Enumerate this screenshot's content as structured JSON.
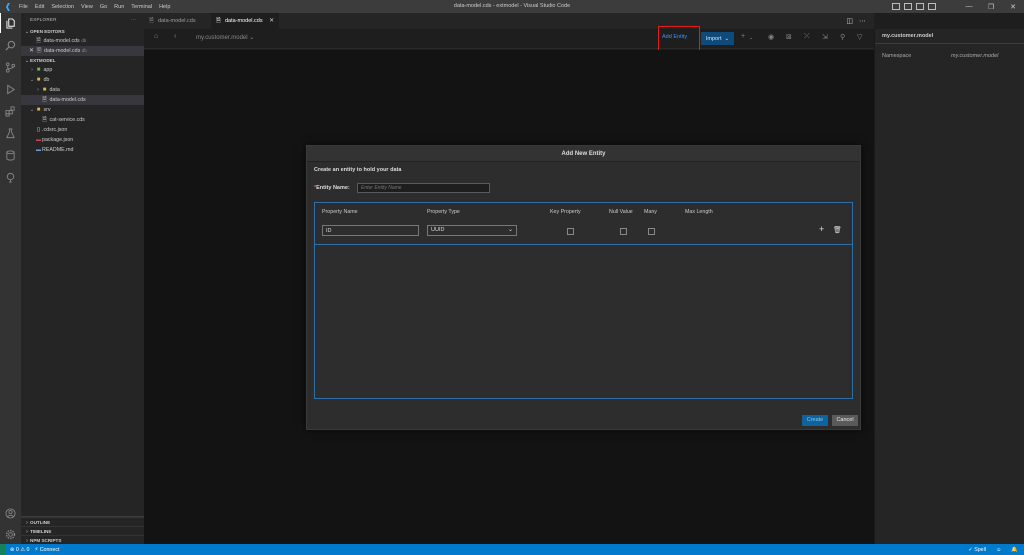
{
  "window": {
    "title": "data-model.cds - extmodel - Visual Studio Code",
    "menus": [
      "File",
      "Edit",
      "Selection",
      "View",
      "Go",
      "Run",
      "Terminal",
      "Help"
    ]
  },
  "activity_bar": {
    "icons": [
      "files-icon",
      "search-icon",
      "source-control-icon",
      "run-debug-icon",
      "extensions-icon",
      "testing-icon",
      "database-icon",
      "cloud-icon"
    ],
    "bottom_icons": [
      "account-icon",
      "manage-gear-icon"
    ]
  },
  "sidebar": {
    "title": "EXPLORER",
    "more": "···",
    "open_editors_header": "OPEN EDITORS",
    "open_editors": [
      {
        "name": "data-model.cds",
        "desc": "db"
      },
      {
        "name": "data-model.cds",
        "desc": "db"
      }
    ],
    "project_header": "EXTMODEL",
    "tree": [
      {
        "label": "app"
      },
      {
        "label": "db"
      },
      {
        "label": "data"
      },
      {
        "label": "data-model.cds"
      },
      {
        "label": "srv"
      },
      {
        "label": "cat-service.cds"
      },
      {
        "label": ".cdsrc.json"
      },
      {
        "label": "package.json"
      },
      {
        "label": "README.md"
      }
    ],
    "outline": "OUTLINE",
    "timeline": "TIMELINE",
    "npm_scripts": "NPM SCRIPTS"
  },
  "tabs": [
    {
      "label": "data-model.cds",
      "active": false
    },
    {
      "label": "data-model.cds",
      "active": true
    }
  ],
  "toolbar": {
    "breadcrumb": "my.customer.model",
    "add_entity": "Add Entity",
    "import": "Import"
  },
  "properties_panel": {
    "title": "my.customer.model",
    "namespace_label": "Namespace",
    "namespace_value": "my.customer.model"
  },
  "dialog": {
    "title": "Add New Entity",
    "subtitle": "Create an entity to hold your data",
    "entity_name_label": "Entity Name:",
    "entity_name_placeholder": "Enter Entity Name",
    "columns": [
      "Property Name",
      "Property Type",
      "Key Property",
      "Null Value",
      "Many",
      "Max Length"
    ],
    "row": {
      "name": "ID",
      "type": "UUID"
    },
    "create": "Create",
    "cancel": "Cancel"
  },
  "statusbar": {
    "problems": "⊗ 0 ⚠ 0",
    "connect": "Connect",
    "spell": "Spell"
  },
  "colors": {
    "accent": "#007acc",
    "highlight_box": "#e01e1e",
    "grid_border": "#2f6ea8"
  }
}
